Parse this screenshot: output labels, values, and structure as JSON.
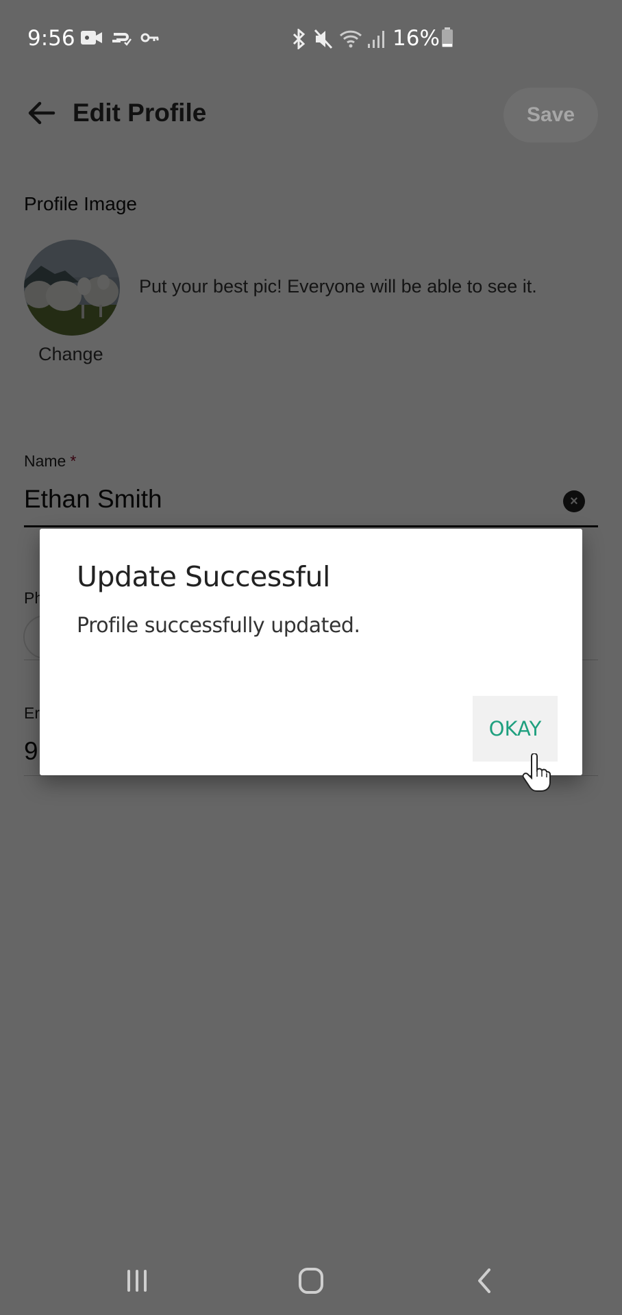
{
  "status_bar": {
    "time": "9:56",
    "left_icons": [
      "video-camera-icon",
      "cast-check-icon",
      "vpn-key-icon"
    ],
    "right_icons": [
      "bluetooth-icon",
      "mute-icon",
      "wifi-icon",
      "signal-icon"
    ],
    "battery_percent": "16%"
  },
  "app_bar": {
    "back_icon": "arrow-left-icon",
    "title": "Edit Profile",
    "save_label": "Save"
  },
  "profile_image": {
    "section_label": "Profile Image",
    "hint": "Put your best pic! Everyone will be able to see it.",
    "change_label": "Change"
  },
  "form": {
    "name": {
      "label": "Name",
      "required_marker": "*",
      "value": "Ethan Smith"
    },
    "phone": {
      "label_visible": "Ph"
    },
    "email": {
      "label_visible": "Er",
      "value_visible": "9"
    }
  },
  "dialog": {
    "title": "Update Successful",
    "message": "Profile successfully updated.",
    "ok_label": "OKAY",
    "accent_color": "#1fa07f"
  },
  "nav_bar": {
    "recents_icon": "recents-icon",
    "home_icon": "home-icon",
    "back_icon": "back-chevron-icon"
  }
}
